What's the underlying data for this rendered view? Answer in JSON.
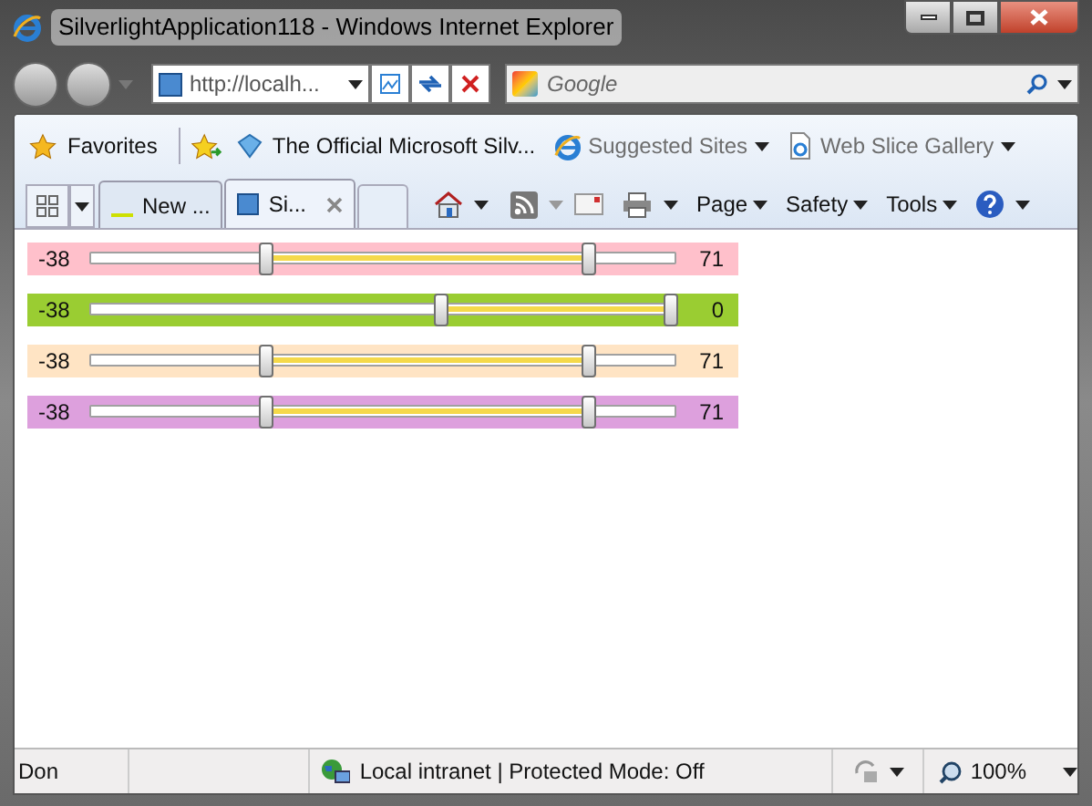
{
  "window": {
    "title": "SilverlightApplication118 - Windows Internet Explorer"
  },
  "address_bar": {
    "url": "http://localh..."
  },
  "search": {
    "placeholder": "Google"
  },
  "favorites_bar": {
    "favorites": "Favorites",
    "links": [
      {
        "label": "The Official Microsoft Silv...",
        "dropdown": false,
        "dim": false
      },
      {
        "label": "Suggested Sites",
        "dropdown": true,
        "dim": true
      },
      {
        "label": "Web Slice Gallery",
        "dropdown": true,
        "dim": true
      }
    ]
  },
  "tabs": [
    {
      "label": "New ...",
      "selected": false,
      "closable": false
    },
    {
      "label": "Si...",
      "selected": true,
      "closable": true
    }
  ],
  "commands": [
    "Page",
    "Safety",
    "Tools"
  ],
  "sliders": [
    {
      "min": "-38",
      "max": "71",
      "color": "#ffc0cb",
      "thumbs": [
        {
          "level": 0.3
        },
        {
          "level": 0.85
        }
      ]
    },
    {
      "min": "-38",
      "max": "0",
      "color": "#9acd32",
      "thumbs": [
        {
          "level": 0.6
        },
        {
          "level": 0.99
        }
      ]
    },
    {
      "min": "-38",
      "max": "71",
      "color": "#ffe4c4",
      "thumbs": [
        {
          "level": 0.3
        },
        {
          "level": 0.85
        }
      ]
    },
    {
      "min": "-38",
      "max": "71",
      "color": "#dda0dd",
      "thumbs": [
        {
          "level": 0.3
        },
        {
          "level": 0.85
        }
      ]
    }
  ],
  "status_bar": {
    "text": "Don",
    "zone": "Local intranet | Protected Mode: Off",
    "zoom": "100%"
  }
}
